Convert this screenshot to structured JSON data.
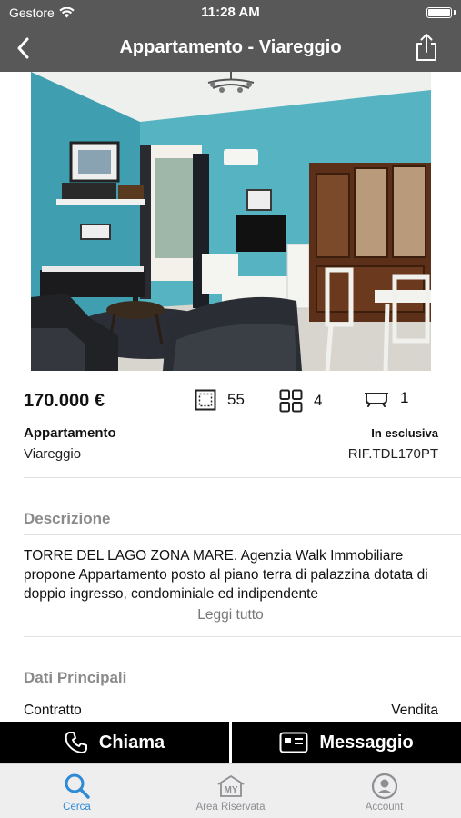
{
  "status_bar": {
    "carrier": "Gestore",
    "time": "11:28 AM"
  },
  "nav": {
    "title": "Appartamento - Viareggio",
    "back_icon": "chevron-left-icon",
    "share_icon": "share-icon"
  },
  "photo": {
    "alt": "living-room-photo"
  },
  "listing": {
    "price": "170.000 €",
    "area": "55",
    "rooms": "4",
    "bathrooms": "1",
    "type": "Appartamento",
    "city": "Viareggio",
    "exclusive": "In esclusiva",
    "reference": "RIF.TDL170PT"
  },
  "description": {
    "title": "Descrizione",
    "text": "TORRE DEL LAGO ZONA MARE. Agenzia Walk Immobiliare propone Appartamento posto al piano terra di palazzina dotata di doppio ingresso, condominiale ed indipendente",
    "read_more": "Leggi tutto"
  },
  "main_data": {
    "title": "Dati Principali",
    "rows": [
      {
        "key": "Contratto",
        "value": "Vendita"
      }
    ]
  },
  "actions": {
    "call": "Chiama",
    "message": "Messaggio"
  },
  "tabs": [
    {
      "label": "Cerca",
      "icon": "search-icon",
      "active": true
    },
    {
      "label": "Area Riservata",
      "icon": "house-my-icon",
      "active": false
    },
    {
      "label": "Account",
      "icon": "account-icon",
      "active": false
    }
  ],
  "colors": {
    "header": "#585858",
    "accent": "#2f8ad6",
    "action_bar": "#000000",
    "tabbar": "#eeeeef"
  }
}
